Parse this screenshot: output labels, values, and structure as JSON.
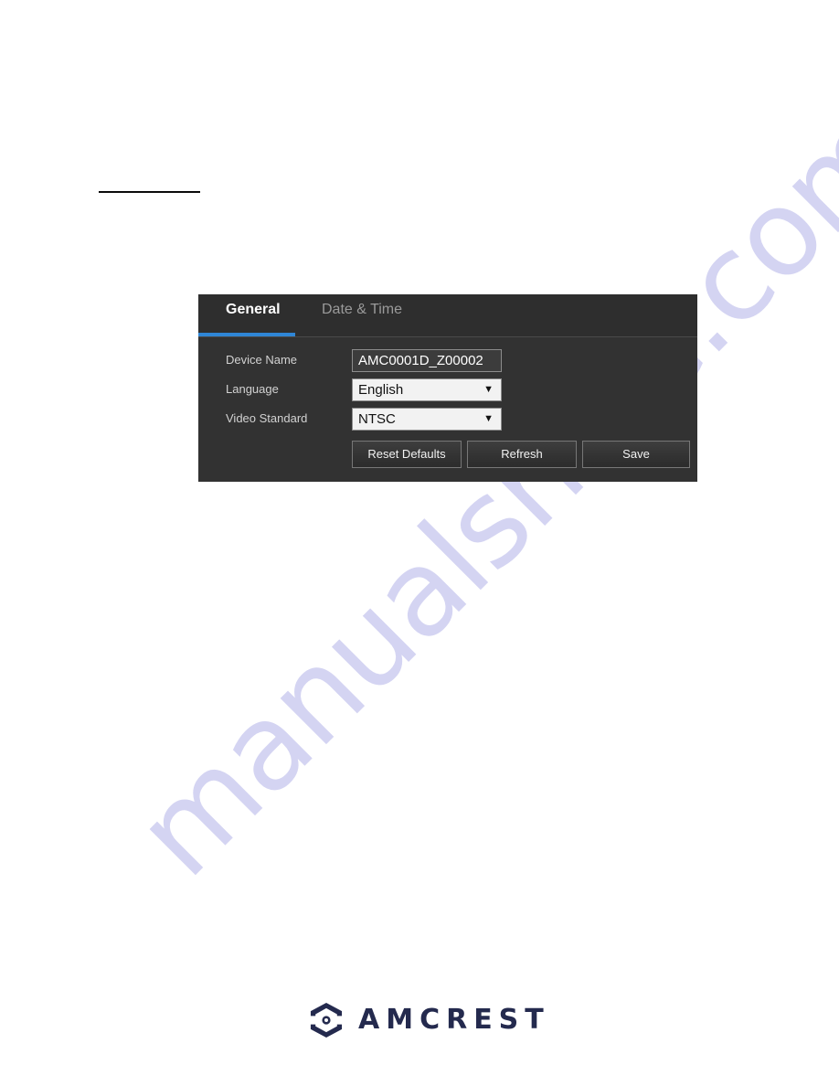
{
  "page": {
    "background_color": "#ffffff",
    "heading_rule": {
      "name": "section-heading-underline"
    }
  },
  "watermark": {
    "text": "manualshive.com",
    "color": "#7878d7"
  },
  "panel": {
    "accent_color": "#2f86d6",
    "background_color": "#323232",
    "header_background_color": "#2e2e2e",
    "tabs": [
      {
        "label": "General",
        "active": true
      },
      {
        "label": "Date & Time",
        "active": false
      }
    ],
    "fields": [
      {
        "label": "Device Name",
        "type": "text",
        "value": "AMC0001D_Z00002",
        "placeholder": "Device Name"
      },
      {
        "label": "Language",
        "type": "select",
        "value": "English",
        "arrow": "▼"
      },
      {
        "label": "Video Standard",
        "type": "select",
        "value": "NTSC",
        "arrow": "▼"
      }
    ],
    "buttons": [
      {
        "label": "Reset Defaults"
      },
      {
        "label": "Refresh"
      },
      {
        "label": "Save"
      }
    ]
  },
  "footer": {
    "brand": "AMCREST",
    "logo_color": "#242a4e",
    "logo_dot_color": "#2f86d6"
  }
}
